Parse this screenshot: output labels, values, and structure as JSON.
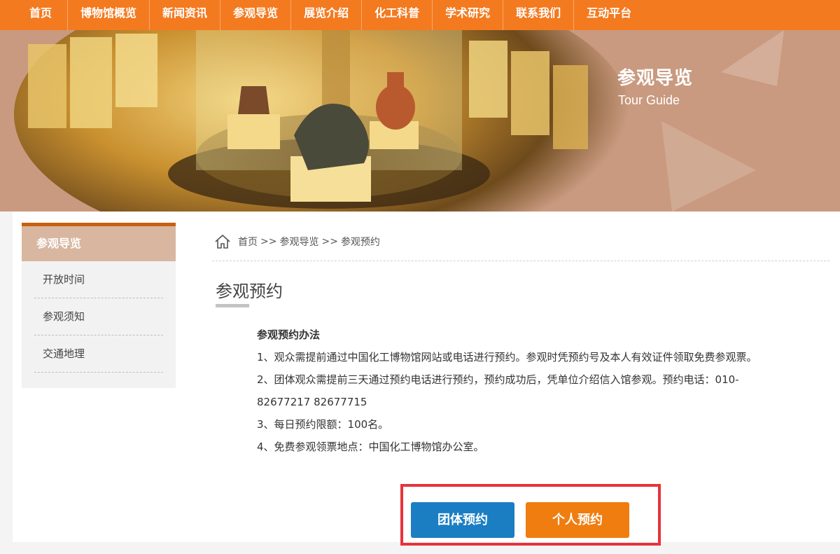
{
  "nav": {
    "items": [
      "首页",
      "博物馆概览",
      "新闻资讯",
      "参观导览",
      "展览介绍",
      "化工科普",
      "学术研究",
      "联系我们",
      "互动平台"
    ]
  },
  "banner": {
    "title": "参观导览",
    "subtitle": "Tour Guide"
  },
  "sidebar": {
    "header": "参观导览",
    "items": [
      "开放时间",
      "参观须知",
      "交通地理"
    ]
  },
  "breadcrumb": {
    "home": "首页",
    "sep": ">>",
    "section": "参观导览",
    "current": "参观预约"
  },
  "page": {
    "title": "参观预约"
  },
  "article": {
    "heading": "参观预约办法",
    "lines": [
      "1、观众需提前通过中国化工博物馆网站或电话进行预约。参观时凭预约号及本人有效证件领取免费参观票。",
      "2、团体观众需提前三天通过预约电话进行预约，预约成功后，凭单位介绍信入馆参观。预约电话：010-82677217 82677715",
      "3、每日预约限额：100名。",
      "4、免费参观领票地点：中国化工博物馆办公室。"
    ]
  },
  "buttons": {
    "group": "团体预约",
    "personal": "个人预约"
  },
  "colors": {
    "nav_bg": "#f47a20",
    "banner_tint": "#c99a7f",
    "group_button": "#1b7ec3",
    "personal_button": "#ef7d10",
    "highlight": "#e8333b"
  },
  "icons": [
    "home-icon"
  ]
}
